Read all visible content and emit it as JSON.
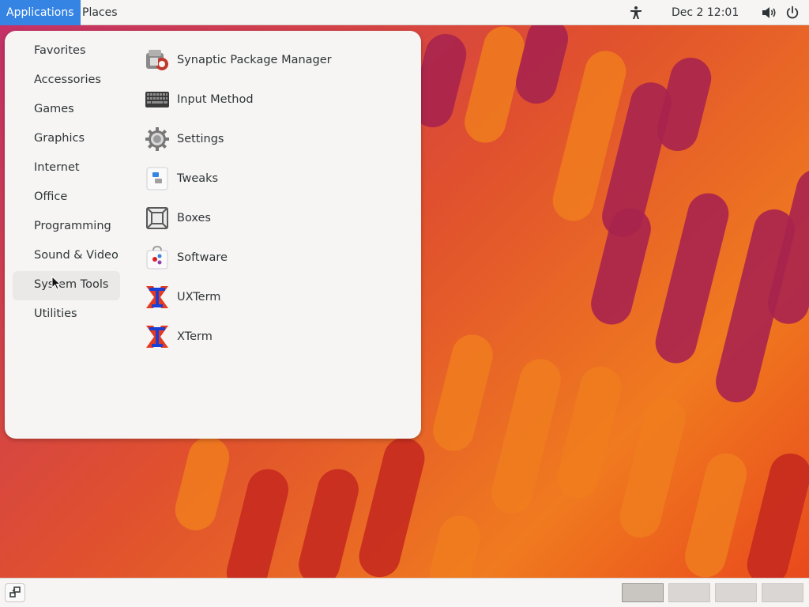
{
  "topbar": {
    "applications_label": "Applications",
    "places_label": "Places",
    "clock": "Dec 2  12:01",
    "icons": [
      "accessibility-icon",
      "volume-icon",
      "power-icon"
    ]
  },
  "categories": [
    {
      "label": "Favorites"
    },
    {
      "label": "Accessories"
    },
    {
      "label": "Games"
    },
    {
      "label": "Graphics"
    },
    {
      "label": "Internet"
    },
    {
      "label": "Office"
    },
    {
      "label": "Programming"
    },
    {
      "label": "Sound & Video"
    },
    {
      "label": "System Tools",
      "selected": true
    },
    {
      "label": "Utilities"
    }
  ],
  "apps": [
    {
      "label": "Synaptic Package Manager",
      "icon": "synaptic-icon"
    },
    {
      "label": "Input Method",
      "icon": "keyboard-icon"
    },
    {
      "label": "Settings",
      "icon": "gear-icon"
    },
    {
      "label": "Tweaks",
      "icon": "tweaks-icon"
    },
    {
      "label": "Boxes",
      "icon": "boxes-icon"
    },
    {
      "label": "Software",
      "icon": "software-icon"
    },
    {
      "label": "UXTerm",
      "icon": "xterm-icon"
    },
    {
      "label": "XTerm",
      "icon": "xterm-icon"
    }
  ],
  "bottombar": {
    "workspaces": 4,
    "active_workspace": 1
  },
  "colors": {
    "accent": "#3584e4",
    "panel_bg": "#f6f5f4",
    "wallpaper_primary": "#e0502e"
  }
}
